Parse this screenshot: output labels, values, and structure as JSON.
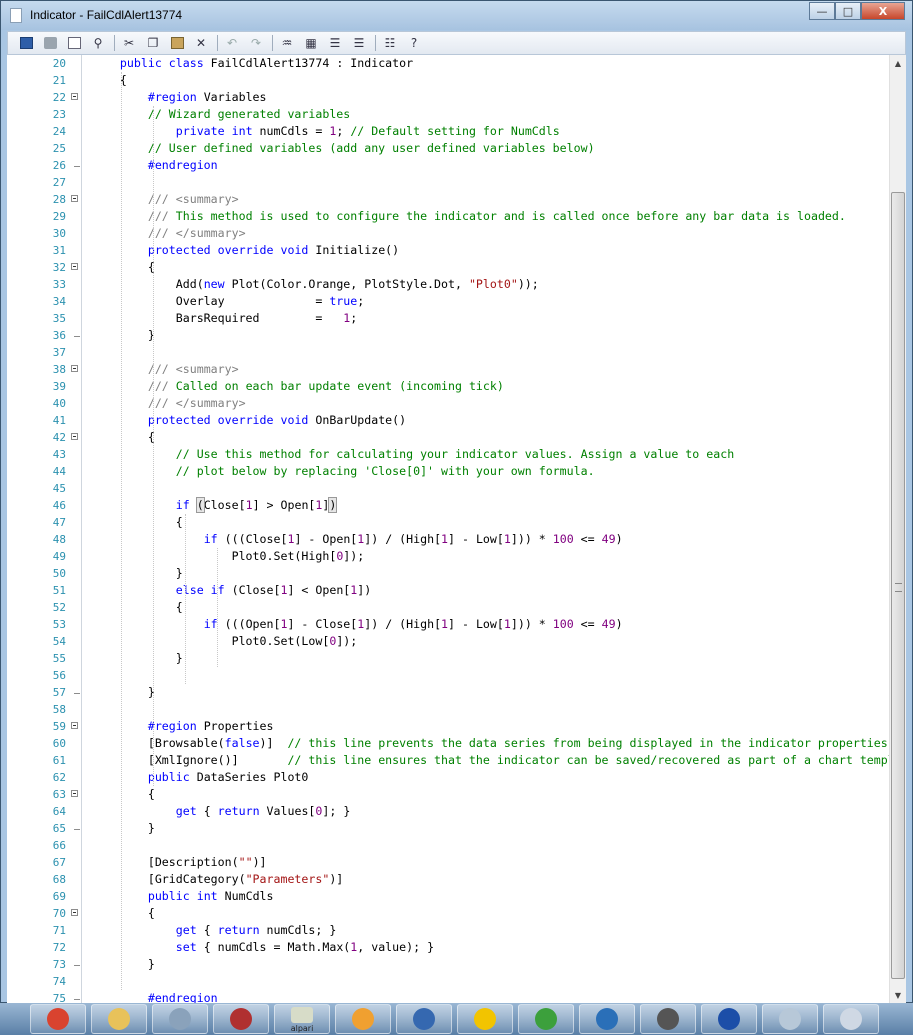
{
  "window": {
    "title": "Indicator - FailCdlAlert13774",
    "minimize": "—",
    "maximize": "□",
    "close": "X"
  },
  "toolbar": [
    "save",
    "print",
    "print-preview",
    "find",
    "cut",
    "copy",
    "paste",
    "delete",
    "undo",
    "redo",
    "search-replace",
    "toggle-bookmark",
    "indent",
    "outdent",
    "comment",
    "uncomment"
  ],
  "colors": {
    "keyword": "#0000ff",
    "comment": "#008000",
    "string": "#a31515",
    "number": "#800080",
    "doc_tag": "#808080",
    "line_number": "#2b91af"
  },
  "editor": {
    "lines": [
      {
        "n": "20",
        "t": [
          [
            "    public class FailCdlAlert13774 : Indicator",
            "k:0-10"
          ]
        ]
      },
      {
        "n": "21",
        "t": "    {"
      },
      {
        "n": "22",
        "fold": "open",
        "t": "        #region Variables"
      },
      {
        "n": "23",
        "t": "        // Wizard generated variables"
      },
      {
        "n": "24",
        "t": "            private int numCdls = 1; // Default setting for NumCdls"
      },
      {
        "n": "25",
        "t": "        // User defined variables (add any user defined variables below)"
      },
      {
        "n": "26",
        "fold": "end",
        "t": "        #endregion"
      },
      {
        "n": "27",
        "t": ""
      },
      {
        "n": "28",
        "fold": "open",
        "t": "        /// <summary>"
      },
      {
        "n": "29",
        "t": "        /// This method is used to configure the indicator and is called once before any bar data is loaded."
      },
      {
        "n": "30",
        "t": "        /// </summary>"
      },
      {
        "n": "31",
        "t": "        protected override void Initialize()"
      },
      {
        "n": "32",
        "fold": "open",
        "t": "        {"
      },
      {
        "n": "33",
        "t": "            Add(new Plot(Color.Orange, PlotStyle.Dot, \"Plot0\"));"
      },
      {
        "n": "34",
        "t": "            Overlay             = true;"
      },
      {
        "n": "35",
        "t": "            BarsRequired        =   1;"
      },
      {
        "n": "36",
        "fold": "end",
        "t": "        }"
      },
      {
        "n": "37",
        "t": ""
      },
      {
        "n": "38",
        "fold": "open",
        "t": "        /// <summary>"
      },
      {
        "n": "39",
        "t": "        /// Called on each bar update event (incoming tick)"
      },
      {
        "n": "40",
        "t": "        /// </summary>"
      },
      {
        "n": "41",
        "t": "        protected override void OnBarUpdate()"
      },
      {
        "n": "42",
        "fold": "open",
        "t": "        {"
      },
      {
        "n": "43",
        "t": "            // Use this method for calculating your indicator values. Assign a value to each"
      },
      {
        "n": "44",
        "t": "            // plot below by replacing 'Close[0]' with your own formula."
      },
      {
        "n": "45",
        "t": ""
      },
      {
        "n": "46",
        "t": "            if (Close[1] > Open[1])"
      },
      {
        "n": "47",
        "t": "            {"
      },
      {
        "n": "48",
        "t": "                if (((Close[1] - Open[1]) / (High[1] - Low[1])) * 100 <= 49)"
      },
      {
        "n": "49",
        "t": "                    Plot0.Set(High[0]);"
      },
      {
        "n": "50",
        "t": "            }"
      },
      {
        "n": "51",
        "t": "            else if (Close[1] < Open[1])"
      },
      {
        "n": "52",
        "t": "            {"
      },
      {
        "n": "53",
        "t": "                if (((Open[1] - Close[1]) / (High[1] - Low[1])) * 100 <= 49)"
      },
      {
        "n": "54",
        "t": "                    Plot0.Set(Low[0]);"
      },
      {
        "n": "55",
        "t": "            }"
      },
      {
        "n": "56",
        "t": ""
      },
      {
        "n": "57",
        "fold": "end",
        "t": "        }"
      },
      {
        "n": "58",
        "t": ""
      },
      {
        "n": "59",
        "fold": "open",
        "t": "        #region Properties"
      },
      {
        "n": "60",
        "t": "        [Browsable(false)]  // this line prevents the data series from being displayed in the indicator properties dialog, do not remove"
      },
      {
        "n": "61",
        "t": "        [XmlIgnore()]       // this line ensures that the indicator can be saved/recovered as part of a chart template, do not remove"
      },
      {
        "n": "62",
        "t": "        public DataSeries Plot0"
      },
      {
        "n": "63",
        "fold": "open",
        "t": "        {"
      },
      {
        "n": "64",
        "t": "            get { return Values[0]; }"
      },
      {
        "n": "65",
        "fold": "end",
        "t": "        }"
      },
      {
        "n": "66",
        "t": ""
      },
      {
        "n": "67",
        "t": "        [Description(\"\")]"
      },
      {
        "n": "68",
        "t": "        [GridCategory(\"Parameters\")]"
      },
      {
        "n": "69",
        "t": "        public int NumCdls"
      },
      {
        "n": "70",
        "fold": "open",
        "t": "        {"
      },
      {
        "n": "71",
        "t": "            get { return numCdls; }"
      },
      {
        "n": "72",
        "t": "            set { numCdls = Math.Max(1, value); }"
      },
      {
        "n": "73",
        "fold": "end",
        "t": "        }"
      },
      {
        "n": "74",
        "t": ""
      },
      {
        "n": "75",
        "fold": "end",
        "t": "        #endregion"
      }
    ]
  },
  "taskbar": {
    "items": [
      "chrome",
      "explorer",
      "calculator",
      "app-red",
      "alpari",
      "paint",
      "defender",
      "warning",
      "download",
      "thunderbird",
      "ninjatrader",
      "app-blue",
      "notepad",
      "wordpad"
    ],
    "alpari_label": "alpari"
  }
}
